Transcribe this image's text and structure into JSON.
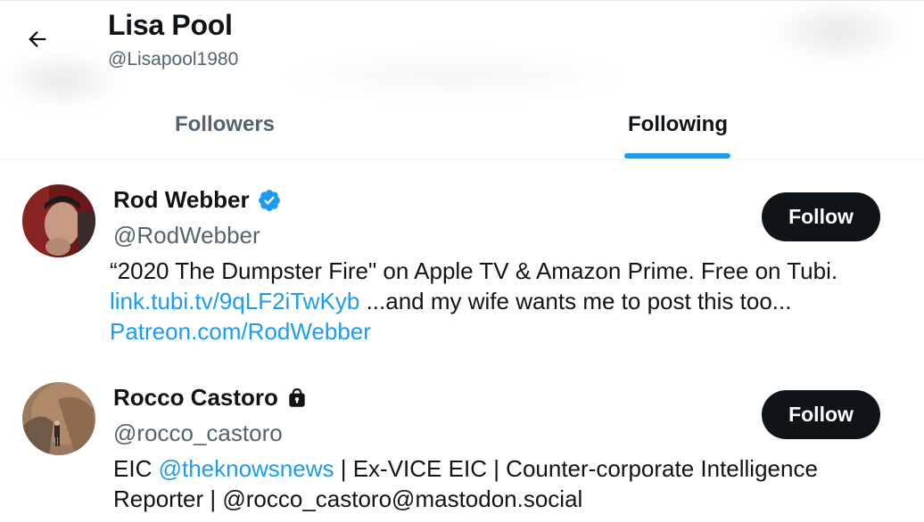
{
  "header": {
    "title": "Lisa Pool",
    "handle": "@Lisapool1980",
    "back_icon": "arrow-left-icon"
  },
  "tabs": [
    {
      "label": "Followers",
      "active": false
    },
    {
      "label": "Following",
      "active": true
    }
  ],
  "colors": {
    "accent": "#1d9bf0",
    "text": "#0f1419",
    "secondary": "#536471",
    "button": "#0f1419"
  },
  "users": [
    {
      "name": "Rod Webber",
      "badge": "verified-badge-icon",
      "handle": "@RodWebber",
      "follow_label": "Follow",
      "bio_line1": "“2020 The Dumpster Fire\" on Apple TV & Amazon Prime. Free on Tubi.",
      "bio_link1": "link.tubi.tv/9qLF2iTwKyb",
      "bio_line2_rest": " ...and my wife wants me to post this too...",
      "bio_link2": "Patreon.com/RodWebber"
    },
    {
      "name": "Rocco Castoro",
      "badge": "lock-icon",
      "handle": "@rocco_castoro",
      "follow_label": "Follow",
      "bio_pre": "EIC ",
      "bio_mention": "@theknowsnews",
      "bio_post": " | Ex-VICE EIC | Counter-corporate Intelligence",
      "bio_line2": "Reporter | @rocco_castoro@mastodon.social"
    }
  ]
}
